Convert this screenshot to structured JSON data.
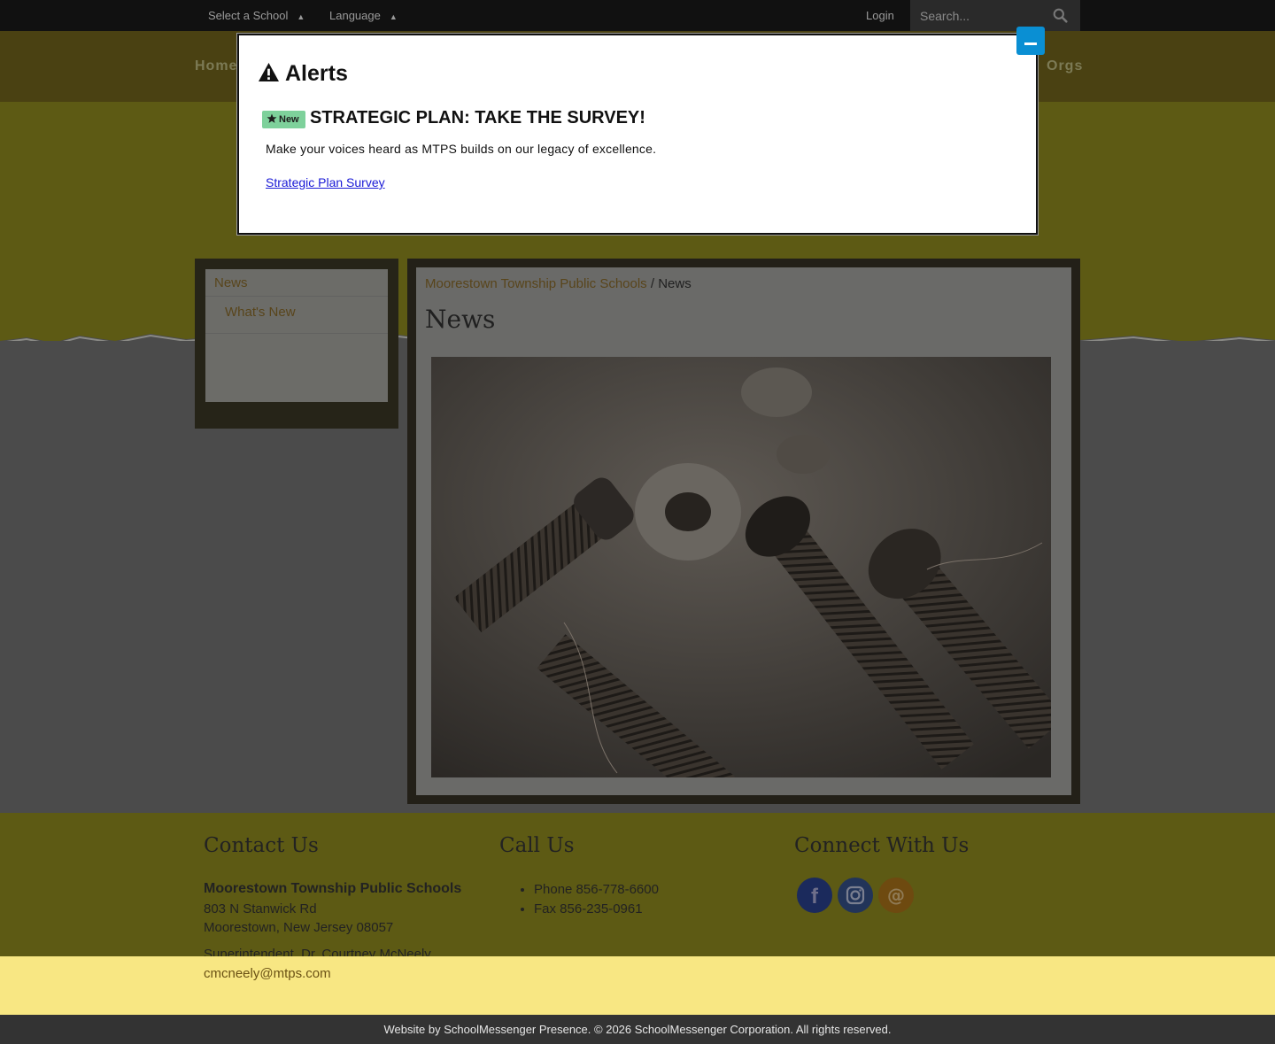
{
  "topbar": {
    "school_select": "Select a School",
    "language_select": "Language",
    "login": "Login",
    "search_placeholder": "Search..."
  },
  "nav": {
    "home": "Home",
    "orgs": "Orgs"
  },
  "sidebar": {
    "title": "News",
    "items": [
      {
        "label": "What's New"
      }
    ]
  },
  "breadcrumb": {
    "root": "Moorestown Township Public Schools",
    "separator": "/",
    "current": "News"
  },
  "page": {
    "title": "News"
  },
  "footer": {
    "contact": {
      "heading": "Contact Us",
      "org": "Moorestown Township Public Schools",
      "address1": "803 N Stanwick Rd",
      "address2": "Moorestown, New Jersey 08057",
      "superintendent": "Superintendent, Dr. Courtney McNeely,",
      "email": "cmcneely@mtps.com"
    },
    "call": {
      "heading": "Call Us",
      "phone": "Phone 856-778-6600",
      "fax": "Fax 856-235-0961"
    },
    "connect": {
      "heading": "Connect With Us",
      "icons": [
        "facebook-icon",
        "instagram-icon",
        "email-icon"
      ]
    }
  },
  "copyright": {
    "prefix": "Website by",
    "link": "SchoolMessenger Presence",
    "suffix": ". © 2026 SchoolMessenger Corporation. All rights reserved."
  },
  "modal": {
    "heading": "Alerts",
    "badge": "New",
    "alert_title": "STRATEGIC PLAN: TAKE THE SURVEY!",
    "alert_body": "Make your voices heard as MTPS builds on our legacy of excellence.",
    "alert_link": "Strategic Plan Survey"
  },
  "colors": {
    "accent_button": "#0a8fd3",
    "badge_bg": "#7ed19b",
    "footer_band": "#f8e783"
  }
}
